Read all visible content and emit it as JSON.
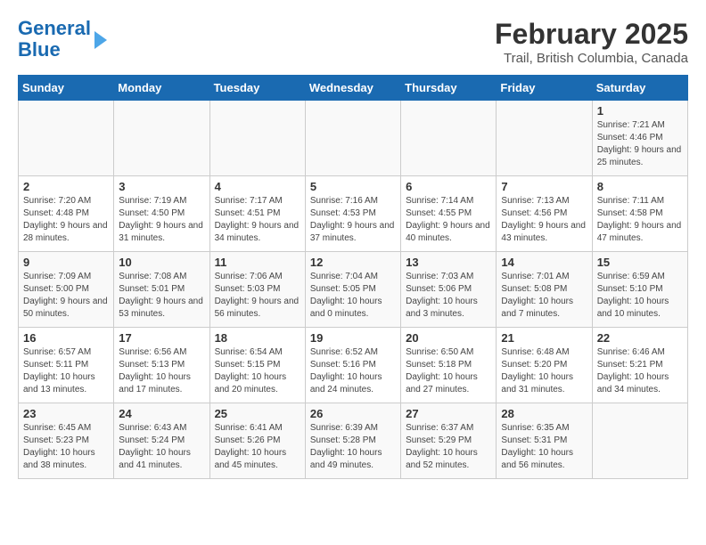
{
  "header": {
    "logo_line1": "General",
    "logo_line2": "Blue",
    "month_title": "February 2025",
    "subtitle": "Trail, British Columbia, Canada"
  },
  "weekdays": [
    "Sunday",
    "Monday",
    "Tuesday",
    "Wednesday",
    "Thursday",
    "Friday",
    "Saturday"
  ],
  "weeks": [
    [
      {
        "day": "",
        "info": ""
      },
      {
        "day": "",
        "info": ""
      },
      {
        "day": "",
        "info": ""
      },
      {
        "day": "",
        "info": ""
      },
      {
        "day": "",
        "info": ""
      },
      {
        "day": "",
        "info": ""
      },
      {
        "day": "1",
        "info": "Sunrise: 7:21 AM\nSunset: 4:46 PM\nDaylight: 9 hours and 25 minutes."
      }
    ],
    [
      {
        "day": "2",
        "info": "Sunrise: 7:20 AM\nSunset: 4:48 PM\nDaylight: 9 hours and 28 minutes."
      },
      {
        "day": "3",
        "info": "Sunrise: 7:19 AM\nSunset: 4:50 PM\nDaylight: 9 hours and 31 minutes."
      },
      {
        "day": "4",
        "info": "Sunrise: 7:17 AM\nSunset: 4:51 PM\nDaylight: 9 hours and 34 minutes."
      },
      {
        "day": "5",
        "info": "Sunrise: 7:16 AM\nSunset: 4:53 PM\nDaylight: 9 hours and 37 minutes."
      },
      {
        "day": "6",
        "info": "Sunrise: 7:14 AM\nSunset: 4:55 PM\nDaylight: 9 hours and 40 minutes."
      },
      {
        "day": "7",
        "info": "Sunrise: 7:13 AM\nSunset: 4:56 PM\nDaylight: 9 hours and 43 minutes."
      },
      {
        "day": "8",
        "info": "Sunrise: 7:11 AM\nSunset: 4:58 PM\nDaylight: 9 hours and 47 minutes."
      }
    ],
    [
      {
        "day": "9",
        "info": "Sunrise: 7:09 AM\nSunset: 5:00 PM\nDaylight: 9 hours and 50 minutes."
      },
      {
        "day": "10",
        "info": "Sunrise: 7:08 AM\nSunset: 5:01 PM\nDaylight: 9 hours and 53 minutes."
      },
      {
        "day": "11",
        "info": "Sunrise: 7:06 AM\nSunset: 5:03 PM\nDaylight: 9 hours and 56 minutes."
      },
      {
        "day": "12",
        "info": "Sunrise: 7:04 AM\nSunset: 5:05 PM\nDaylight: 10 hours and 0 minutes."
      },
      {
        "day": "13",
        "info": "Sunrise: 7:03 AM\nSunset: 5:06 PM\nDaylight: 10 hours and 3 minutes."
      },
      {
        "day": "14",
        "info": "Sunrise: 7:01 AM\nSunset: 5:08 PM\nDaylight: 10 hours and 7 minutes."
      },
      {
        "day": "15",
        "info": "Sunrise: 6:59 AM\nSunset: 5:10 PM\nDaylight: 10 hours and 10 minutes."
      }
    ],
    [
      {
        "day": "16",
        "info": "Sunrise: 6:57 AM\nSunset: 5:11 PM\nDaylight: 10 hours and 13 minutes."
      },
      {
        "day": "17",
        "info": "Sunrise: 6:56 AM\nSunset: 5:13 PM\nDaylight: 10 hours and 17 minutes."
      },
      {
        "day": "18",
        "info": "Sunrise: 6:54 AM\nSunset: 5:15 PM\nDaylight: 10 hours and 20 minutes."
      },
      {
        "day": "19",
        "info": "Sunrise: 6:52 AM\nSunset: 5:16 PM\nDaylight: 10 hours and 24 minutes."
      },
      {
        "day": "20",
        "info": "Sunrise: 6:50 AM\nSunset: 5:18 PM\nDaylight: 10 hours and 27 minutes."
      },
      {
        "day": "21",
        "info": "Sunrise: 6:48 AM\nSunset: 5:20 PM\nDaylight: 10 hours and 31 minutes."
      },
      {
        "day": "22",
        "info": "Sunrise: 6:46 AM\nSunset: 5:21 PM\nDaylight: 10 hours and 34 minutes."
      }
    ],
    [
      {
        "day": "23",
        "info": "Sunrise: 6:45 AM\nSunset: 5:23 PM\nDaylight: 10 hours and 38 minutes."
      },
      {
        "day": "24",
        "info": "Sunrise: 6:43 AM\nSunset: 5:24 PM\nDaylight: 10 hours and 41 minutes."
      },
      {
        "day": "25",
        "info": "Sunrise: 6:41 AM\nSunset: 5:26 PM\nDaylight: 10 hours and 45 minutes."
      },
      {
        "day": "26",
        "info": "Sunrise: 6:39 AM\nSunset: 5:28 PM\nDaylight: 10 hours and 49 minutes."
      },
      {
        "day": "27",
        "info": "Sunrise: 6:37 AM\nSunset: 5:29 PM\nDaylight: 10 hours and 52 minutes."
      },
      {
        "day": "28",
        "info": "Sunrise: 6:35 AM\nSunset: 5:31 PM\nDaylight: 10 hours and 56 minutes."
      },
      {
        "day": "",
        "info": ""
      }
    ]
  ]
}
